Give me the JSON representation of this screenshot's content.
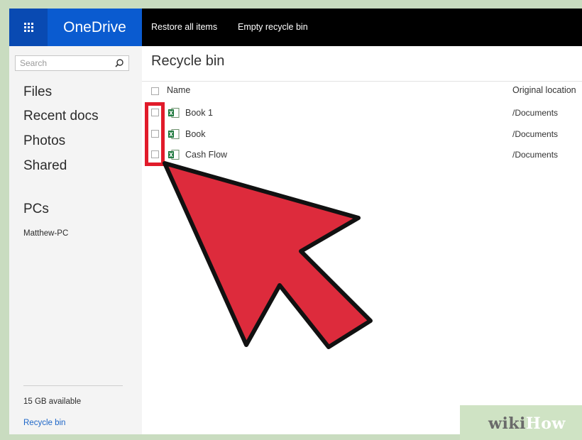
{
  "topbar": {
    "brand": "OneDrive",
    "commands": [
      "Restore all items",
      "Empty recycle bin"
    ]
  },
  "sidebar": {
    "search_placeholder": "Search",
    "nav": [
      "Files",
      "Recent docs",
      "Photos",
      "Shared"
    ],
    "pcs_heading": "PCs",
    "pc_name": "Matthew-PC",
    "storage": "15 GB available",
    "recycle_link": "Recycle bin"
  },
  "main": {
    "title": "Recycle bin",
    "columns": {
      "name": "Name",
      "location": "Original location"
    },
    "files": [
      {
        "name": "Book 1",
        "location": "/Documents"
      },
      {
        "name": "Book",
        "location": "/Documents"
      },
      {
        "name": "Cash Flow",
        "location": "/Documents"
      }
    ]
  },
  "watermark": {
    "part1": "wiki",
    "part2": "How"
  },
  "colors": {
    "accent": "#0a5bd0",
    "waffle": "#094ab2",
    "highlight": "#e11b2a",
    "arrow": "#dd2b3c"
  },
  "icons": [
    "app-launcher-icon",
    "search-icon",
    "excel-file-icon",
    "pointer-arrow-icon"
  ]
}
